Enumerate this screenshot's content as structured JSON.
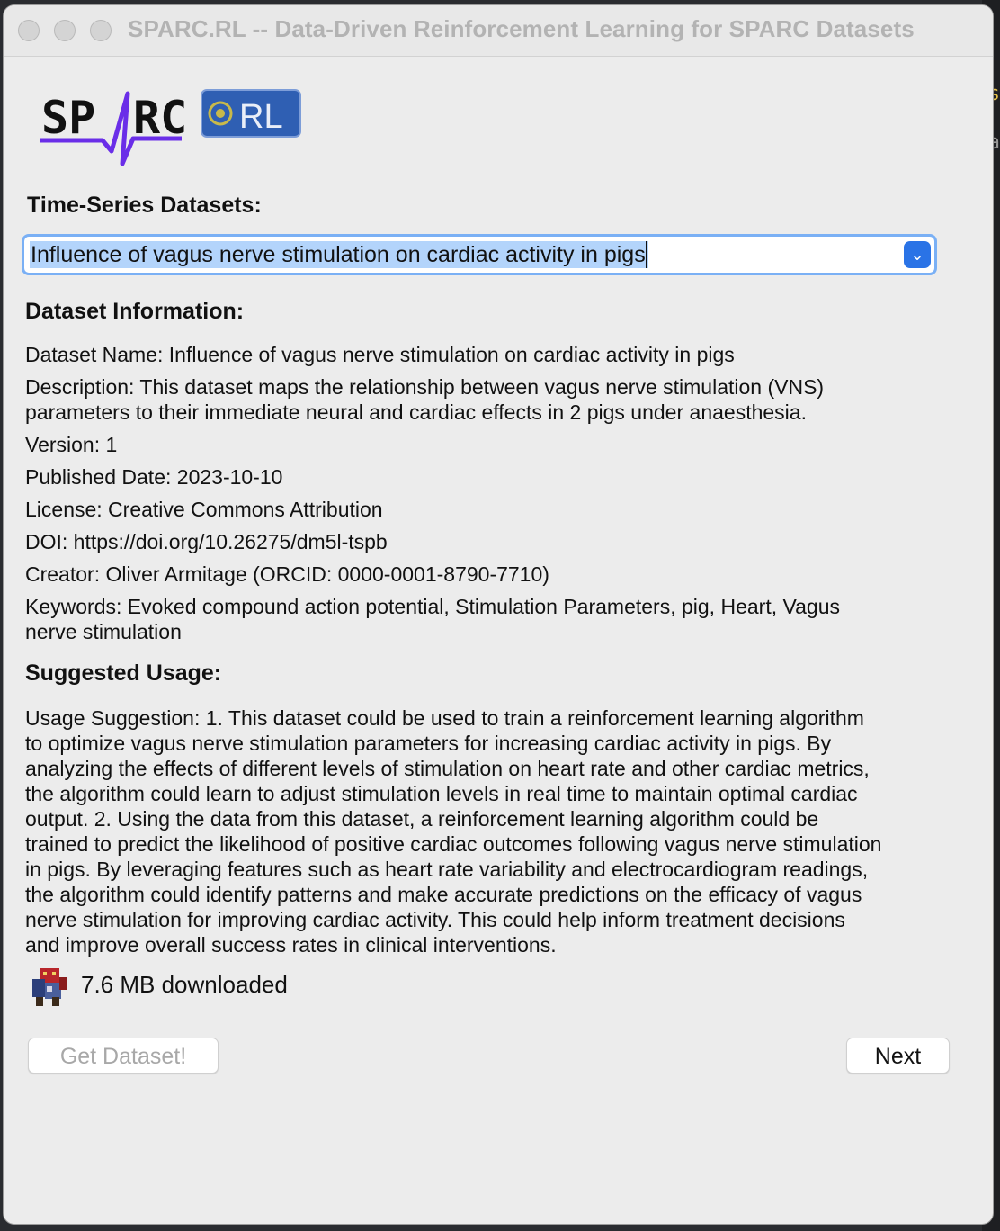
{
  "window": {
    "title": "SPARC.RL -- Data-Driven Reinforcement Learning for SPARC Datasets"
  },
  "logo": {
    "brand": "SPARC",
    "badge": "RL"
  },
  "datasets": {
    "label": "Time-Series Datasets:",
    "selected": "Influence of vagus nerve stimulation on cardiac activity in pigs"
  },
  "info": {
    "heading": "Dataset Information:",
    "name": "Dataset Name: Influence of vagus nerve stimulation on cardiac activity in pigs",
    "description_line1": "Description: This dataset maps the relationship between vagus nerve stimulation (VNS)",
    "description_line2": "parameters to their immediate neural and cardiac effects in 2 pigs under anaesthesia.",
    "version": "Version: 1",
    "published": "Published Date: 2023-10-10",
    "license": "License: Creative Commons Attribution",
    "doi": "DOI: https://doi.org/10.26275/dm5l-tspb",
    "creator": "Creator: Oliver Armitage (ORCID: 0000-0001-8790-7710)",
    "keywords_line1": "Keywords: Evoked compound action potential, Stimulation Parameters, pig, Heart, Vagus",
    "keywords_line2": "nerve stimulation"
  },
  "usage": {
    "heading": "Suggested Usage:",
    "lines": [
      "Usage Suggestion: 1. This dataset could be used to train a reinforcement learning algorithm",
      "to optimize vagus nerve stimulation parameters for increasing cardiac activity in pigs. By",
      "analyzing the effects of different levels of stimulation on heart rate and other cardiac metrics,",
      "the algorithm could learn to adjust stimulation levels in real time to maintain optimal cardiac",
      "output.  2. Using the data from this dataset, a reinforcement learning algorithm could be",
      "trained to predict the likelihood of positive cardiac outcomes following vagus nerve stimulation",
      "in pigs. By leveraging features such as heart rate variability and electrocardiogram readings,",
      "the algorithm could identify patterns and make accurate predictions on the efficacy of vagus",
      "nerve stimulation for improving cardiac activity. This could help inform treatment decisions",
      "and improve overall success rates in clinical interventions."
    ]
  },
  "download": {
    "status": "7.6 MB downloaded"
  },
  "buttons": {
    "get_dataset": "Get Dataset!",
    "next": "Next"
  },
  "colors": {
    "accent": "#2a73e6",
    "selection": "#b3d4fb",
    "focus_ring": "#7ab0f5",
    "logo_purple": "#6a2ee8",
    "badge_blue": "#2f5fb3"
  }
}
